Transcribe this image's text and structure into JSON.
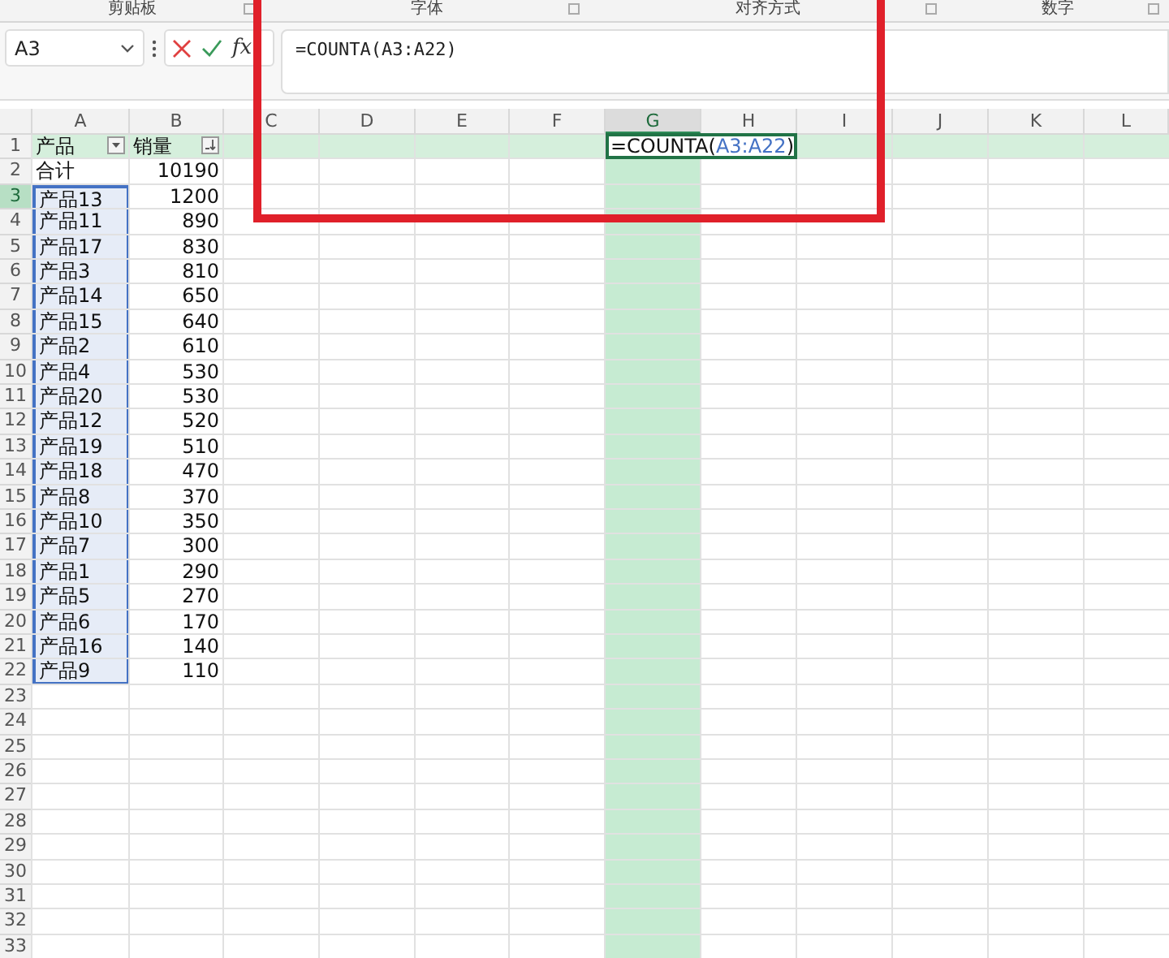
{
  "ribbon_groups": [
    "剪贴板",
    "字体",
    "对齐方式",
    "数字"
  ],
  "name_box": "A3",
  "formula_bar": {
    "fx": "fx",
    "formula": "=COUNTA(A3:A22)"
  },
  "columns": [
    {
      "label": "A",
      "highlighted": false
    },
    {
      "label": "B",
      "highlighted": false
    },
    {
      "label": "C",
      "highlighted": false
    },
    {
      "label": "D",
      "highlighted": false
    },
    {
      "label": "E",
      "highlighted": false
    },
    {
      "label": "F",
      "highlighted": false
    },
    {
      "label": "G",
      "highlighted": true
    },
    {
      "label": "H",
      "highlighted": false
    },
    {
      "label": "I",
      "highlighted": false
    },
    {
      "label": "J",
      "highlighted": false
    },
    {
      "label": "K",
      "highlighted": false
    },
    {
      "label": "L",
      "highlighted": false
    }
  ],
  "editor": {
    "prefix": "=COUNTA(",
    "range": "A3:A22",
    "suffix": ")"
  },
  "rows": [
    {
      "number": "1",
      "kind": "header",
      "active": false,
      "highlighted": true,
      "in_selection": false,
      "cells": [
        "产品",
        "销量"
      ]
    },
    {
      "number": "2",
      "kind": "data",
      "active": false,
      "highlighted": false,
      "in_selection": false,
      "cells": [
        "合计",
        "10190"
      ]
    },
    {
      "number": "3",
      "kind": "data",
      "active": true,
      "highlighted": false,
      "in_selection": true,
      "cells": [
        "产品13",
        "1200"
      ]
    },
    {
      "number": "4",
      "kind": "data",
      "active": false,
      "highlighted": false,
      "in_selection": true,
      "cells": [
        "产品11",
        "890"
      ]
    },
    {
      "number": "5",
      "kind": "data",
      "active": false,
      "highlighted": false,
      "in_selection": true,
      "cells": [
        "产品17",
        "830"
      ]
    },
    {
      "number": "6",
      "kind": "data",
      "active": false,
      "highlighted": false,
      "in_selection": true,
      "cells": [
        "产品3",
        "810"
      ]
    },
    {
      "number": "7",
      "kind": "data",
      "active": false,
      "highlighted": false,
      "in_selection": true,
      "cells": [
        "产品14",
        "650"
      ]
    },
    {
      "number": "8",
      "kind": "data",
      "active": false,
      "highlighted": false,
      "in_selection": true,
      "cells": [
        "产品15",
        "640"
      ]
    },
    {
      "number": "9",
      "kind": "data",
      "active": false,
      "highlighted": false,
      "in_selection": true,
      "cells": [
        "产品2",
        "610"
      ]
    },
    {
      "number": "10",
      "kind": "data",
      "active": false,
      "highlighted": false,
      "in_selection": true,
      "cells": [
        "产品4",
        "530"
      ]
    },
    {
      "number": "11",
      "kind": "data",
      "active": false,
      "highlighted": false,
      "in_selection": true,
      "cells": [
        "产品20",
        "530"
      ]
    },
    {
      "number": "12",
      "kind": "data",
      "active": false,
      "highlighted": false,
      "in_selection": true,
      "cells": [
        "产品12",
        "520"
      ]
    },
    {
      "number": "13",
      "kind": "data",
      "active": false,
      "highlighted": false,
      "in_selection": true,
      "cells": [
        "产品19",
        "510"
      ]
    },
    {
      "number": "14",
      "kind": "data",
      "active": false,
      "highlighted": false,
      "in_selection": true,
      "cells": [
        "产品18",
        "470"
      ]
    },
    {
      "number": "15",
      "kind": "data",
      "active": false,
      "highlighted": false,
      "in_selection": true,
      "cells": [
        "产品8",
        "370"
      ]
    },
    {
      "number": "16",
      "kind": "data",
      "active": false,
      "highlighted": false,
      "in_selection": true,
      "cells": [
        "产品10",
        "350"
      ]
    },
    {
      "number": "17",
      "kind": "data",
      "active": false,
      "highlighted": false,
      "in_selection": true,
      "cells": [
        "产品7",
        "300"
      ]
    },
    {
      "number": "18",
      "kind": "data",
      "active": false,
      "highlighted": false,
      "in_selection": true,
      "cells": [
        "产品1",
        "290"
      ]
    },
    {
      "number": "19",
      "kind": "data",
      "active": false,
      "highlighted": false,
      "in_selection": true,
      "cells": [
        "产品5",
        "270"
      ]
    },
    {
      "number": "20",
      "kind": "data",
      "active": false,
      "highlighted": false,
      "in_selection": true,
      "cells": [
        "产品6",
        "170"
      ]
    },
    {
      "number": "21",
      "kind": "data",
      "active": false,
      "highlighted": false,
      "in_selection": true,
      "cells": [
        "产品16",
        "140"
      ]
    },
    {
      "number": "22",
      "kind": "data",
      "active": false,
      "highlighted": false,
      "in_selection": true,
      "cells": [
        "产品9",
        "110"
      ]
    },
    {
      "number": "23",
      "kind": "empty",
      "active": false,
      "highlighted": false,
      "in_selection": false
    },
    {
      "number": "24",
      "kind": "empty",
      "active": false,
      "highlighted": false,
      "in_selection": false
    },
    {
      "number": "25",
      "kind": "empty",
      "active": false,
      "highlighted": false,
      "in_selection": false
    },
    {
      "number": "26",
      "kind": "empty",
      "active": false,
      "highlighted": false,
      "in_selection": false
    },
    {
      "number": "27",
      "kind": "empty",
      "active": false,
      "highlighted": false,
      "in_selection": false
    },
    {
      "number": "28",
      "kind": "empty",
      "active": false,
      "highlighted": false,
      "in_selection": false
    },
    {
      "number": "29",
      "kind": "empty",
      "active": false,
      "highlighted": false,
      "in_selection": false
    },
    {
      "number": "30",
      "kind": "empty",
      "active": false,
      "highlighted": false,
      "in_selection": false
    },
    {
      "number": "31",
      "kind": "empty",
      "active": false,
      "highlighted": false,
      "in_selection": false
    },
    {
      "number": "32",
      "kind": "empty",
      "active": false,
      "highlighted": false,
      "in_selection": false
    },
    {
      "number": "33",
      "kind": "empty",
      "active": false,
      "highlighted": false,
      "in_selection": false
    }
  ]
}
